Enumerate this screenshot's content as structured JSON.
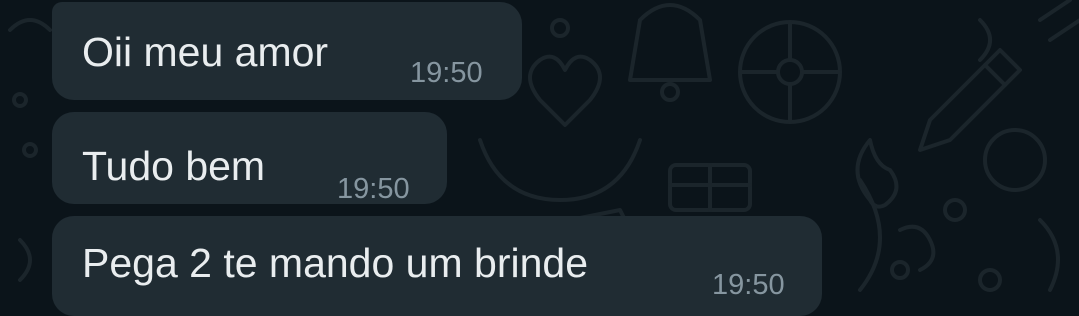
{
  "theme": {
    "background": "#0b141a",
    "bubble_incoming": "#202c33",
    "text_color": "#e9edef",
    "time_color": "#8696a0"
  },
  "messages": [
    {
      "text": "Oii meu amor",
      "time": "19:50",
      "direction": "incoming"
    },
    {
      "text": "Tudo bem",
      "time": "19:50",
      "direction": "incoming"
    },
    {
      "text": "Pega 2 te mando um brinde",
      "time": "19:50",
      "direction": "incoming"
    }
  ]
}
